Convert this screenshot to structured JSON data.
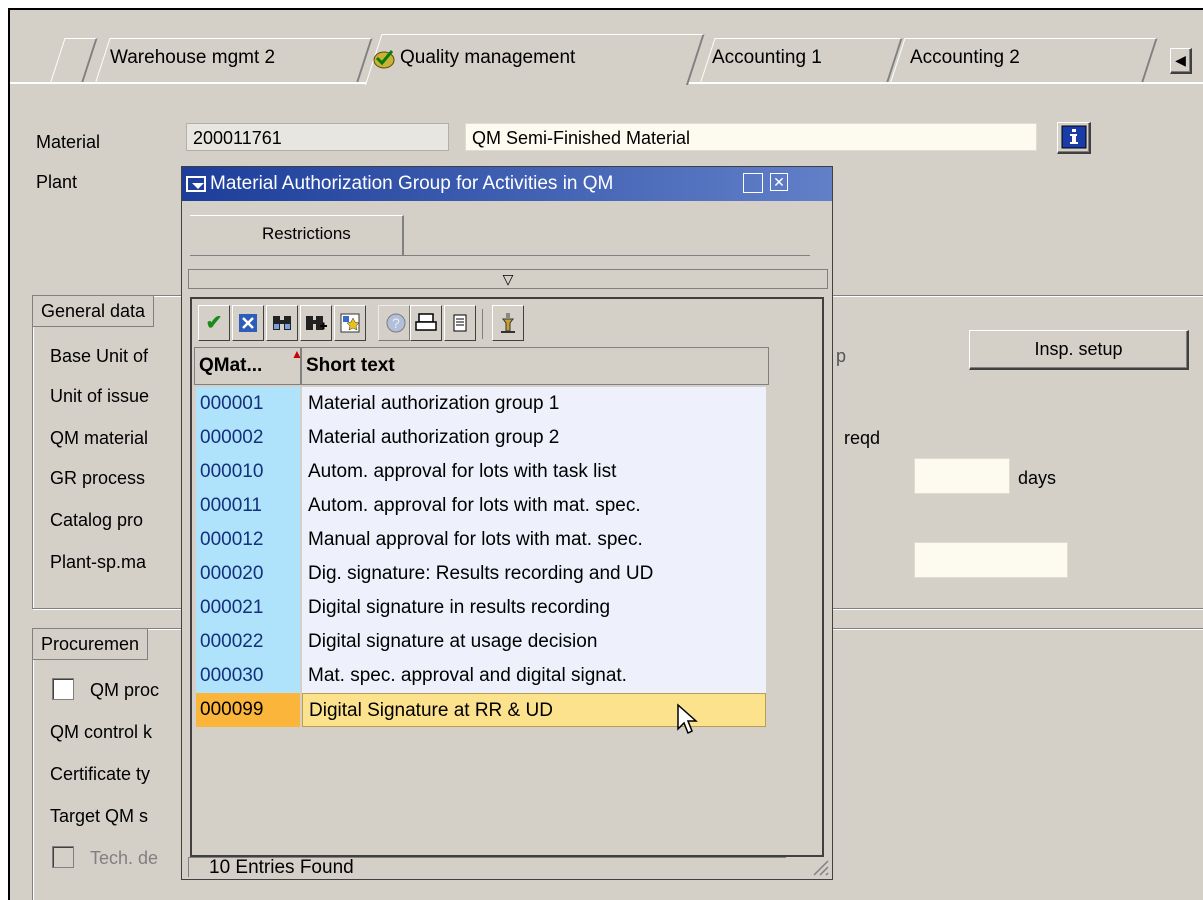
{
  "tabs": [
    {
      "label": "Warehouse mgmt 2"
    },
    {
      "label": "Quality management"
    },
    {
      "label": "Accounting 1"
    },
    {
      "label": "Accounting 2"
    }
  ],
  "header": {
    "material_label": "Material",
    "material_value": "200011761",
    "material_desc": "QM Semi-Finished Material",
    "plant_label": "Plant"
  },
  "general": {
    "title": "General data",
    "rows": [
      "Base Unit of",
      "Unit of issue",
      "QM material",
      "GR process",
      "Catalog pro",
      "Plant-sp.ma"
    ],
    "right_p": "p",
    "right_reqd": "reqd",
    "days_label": "days",
    "insp_setup": "Insp. setup"
  },
  "procurement": {
    "title": "Procuremen",
    "qm_proc": "QM proc",
    "rows": [
      "QM control k",
      "Certificate ty",
      "Target QM s"
    ],
    "tech": "Tech. de"
  },
  "popup": {
    "title": "Material Authorization Group for Activities in QM",
    "restrictions_tab": "Restrictions",
    "col_key": "QMat...",
    "col_text": "Short text",
    "entries": [
      {
        "key": "000001",
        "text": "Material authorization group 1"
      },
      {
        "key": "000002",
        "text": "Material authorization group 2"
      },
      {
        "key": "000010",
        "text": "Autom. approval for lots with task list"
      },
      {
        "key": "000011",
        "text": "Autom. approval for lots with mat. spec."
      },
      {
        "key": "000012",
        "text": "Manual approval for lots with mat. spec."
      },
      {
        "key": "000020",
        "text": "Dig. signature: Results recording and UD"
      },
      {
        "key": "000021",
        "text": "Digital signature in results recording"
      },
      {
        "key": "000022",
        "text": "Digital signature at usage decision"
      },
      {
        "key": "000030",
        "text": "Mat. spec. approval and digital signat."
      },
      {
        "key": "000099",
        "text": "Digital Signature at RR & UD"
      }
    ],
    "status": "10 Entries Found"
  },
  "colors": {
    "title_bar": "#1c3d9a",
    "key_cell": "#aee3fb",
    "selected_key": "#fbb53a",
    "selected_text": "#fde28e"
  },
  "icons": [
    "check-icon",
    "cancel-icon",
    "find-icon",
    "find-next-icon",
    "new-entry-icon",
    "help-icon",
    "print-icon",
    "list-icon",
    "sort-icon",
    "info-icon"
  ]
}
